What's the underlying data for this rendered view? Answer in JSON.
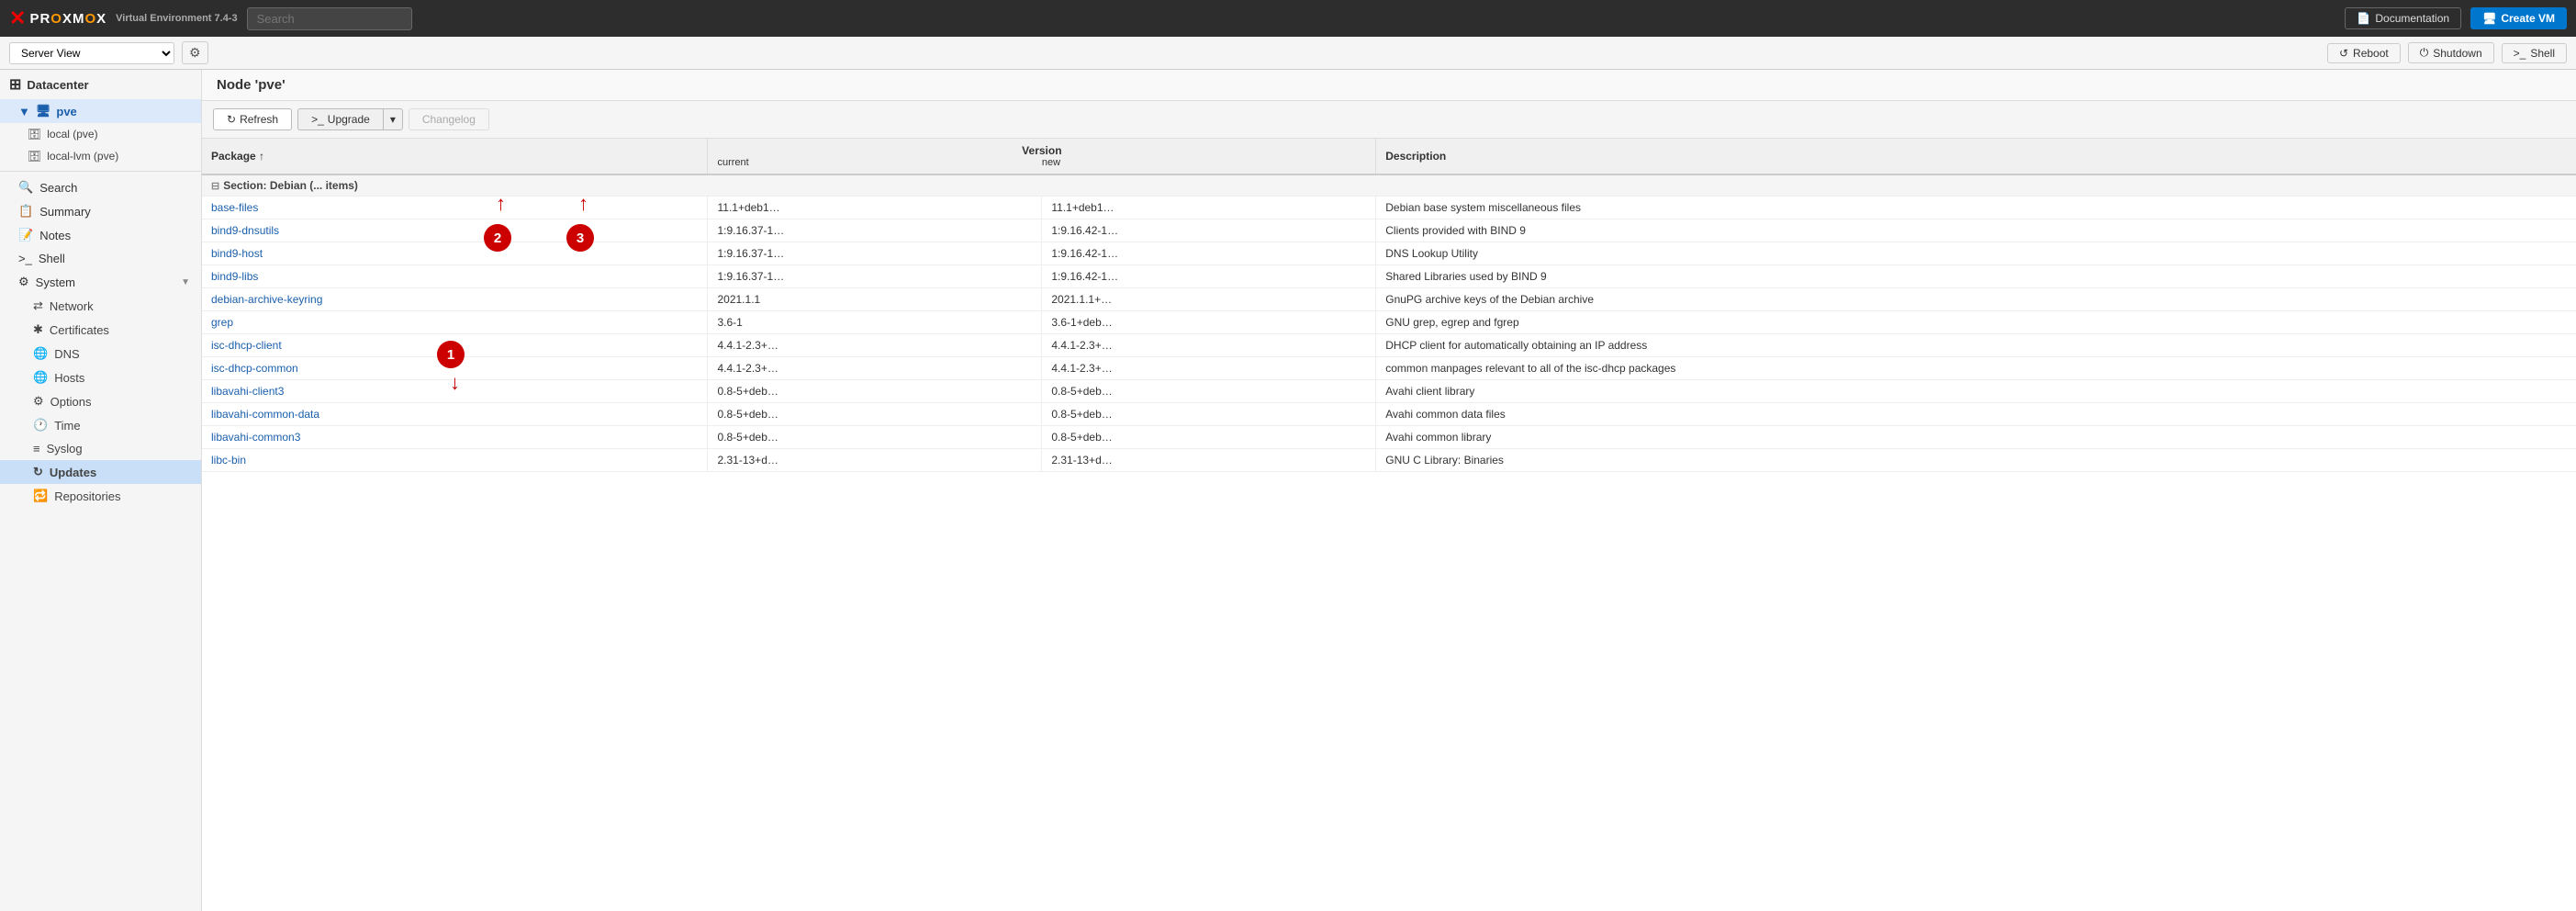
{
  "topbar": {
    "logo": {
      "brand": "PROXMOX",
      "product": "Virtual Environment 7.4-3"
    },
    "search_placeholder": "Search",
    "docs_btn": "Documentation",
    "create_vm_btn": "Create VM"
  },
  "serverbar": {
    "view_label": "Server View",
    "gear_icon": "⚙",
    "reboot_btn": "Reboot",
    "shutdown_btn": "Shutdown",
    "shell_btn": "Shell"
  },
  "sidebar": {
    "datacenter_label": "Datacenter",
    "node_label": "pve",
    "storages": [
      {
        "name": "local (pve)"
      },
      {
        "name": "local-lvm (pve)"
      }
    ],
    "menu_items": [
      {
        "id": "search",
        "icon": "🔍",
        "label": "Search"
      },
      {
        "id": "summary",
        "icon": "📋",
        "label": "Summary"
      },
      {
        "id": "notes",
        "icon": "📝",
        "label": "Notes"
      },
      {
        "id": "shell",
        "icon": ">_",
        "label": "Shell"
      },
      {
        "id": "system",
        "icon": "⚙",
        "label": "System",
        "has_arrow": true
      },
      {
        "id": "network",
        "icon": "⇄",
        "label": "Network",
        "sub": true
      },
      {
        "id": "certificates",
        "icon": "✱",
        "label": "Certificates",
        "sub": true
      },
      {
        "id": "dns",
        "icon": "🌐",
        "label": "DNS",
        "sub": true
      },
      {
        "id": "hosts",
        "icon": "🌐",
        "label": "Hosts",
        "sub": true
      },
      {
        "id": "options",
        "icon": "⚙",
        "label": "Options",
        "sub": true
      },
      {
        "id": "time",
        "icon": "🕐",
        "label": "Time",
        "sub": true
      },
      {
        "id": "syslog",
        "icon": "≡",
        "label": "Syslog",
        "sub": true
      },
      {
        "id": "updates",
        "icon": "↻",
        "label": "Updates",
        "sub": true,
        "active": true
      },
      {
        "id": "repositories",
        "icon": "🔁",
        "label": "Repositories",
        "sub": true
      }
    ]
  },
  "content": {
    "header_title": "Node 'pve'",
    "toolbar": {
      "refresh_btn": "Refresh",
      "upgrade_btn": "Upgrade",
      "upgrade_dropdown": "▾",
      "changelog_btn": "Changelog"
    },
    "table": {
      "columns": [
        {
          "id": "package",
          "label": "Package ↑"
        },
        {
          "id": "version_header",
          "label": "Version"
        },
        {
          "id": "current",
          "label": "current"
        },
        {
          "id": "new",
          "label": "new"
        },
        {
          "id": "description",
          "label": "Description"
        }
      ],
      "group": "Section: Debian (... items)",
      "rows": [
        {
          "package": "base-files",
          "current": "11.1+deb1…",
          "new": "11.1+deb1…",
          "description": "Debian base system miscellaneous files"
        },
        {
          "package": "bind9-dnsutils",
          "current": "1:9.16.37-1…",
          "new": "1:9.16.42-1…",
          "description": "Clients provided with BIND 9"
        },
        {
          "package": "bind9-host",
          "current": "1:9.16.37-1…",
          "new": "1:9.16.42-1…",
          "description": "DNS Lookup Utility"
        },
        {
          "package": "bind9-libs",
          "current": "1:9.16.37-1…",
          "new": "1:9.16.42-1…",
          "description": "Shared Libraries used by BIND 9"
        },
        {
          "package": "debian-archive-keyring",
          "current": "2021.1.1",
          "new": "2021.1.1+…",
          "description": "GnuPG archive keys of the Debian archive"
        },
        {
          "package": "grep",
          "current": "3.6-1",
          "new": "3.6-1+deb…",
          "description": "GNU grep, egrep and fgrep"
        },
        {
          "package": "isc-dhcp-client",
          "current": "4.4.1-2.3+…",
          "new": "4.4.1-2.3+…",
          "description": "DHCP client for automatically obtaining an IP address"
        },
        {
          "package": "isc-dhcp-common",
          "current": "4.4.1-2.3+…",
          "new": "4.4.1-2.3+…",
          "description": "common manpages relevant to all of the isc-dhcp packages"
        },
        {
          "package": "libavahi-client3",
          "current": "0.8-5+deb…",
          "new": "0.8-5+deb…",
          "description": "Avahi client library"
        },
        {
          "package": "libavahi-common-data",
          "current": "0.8-5+deb…",
          "new": "0.8-5+deb…",
          "description": "Avahi common data files"
        },
        {
          "package": "libavahi-common3",
          "current": "0.8-5+deb…",
          "new": "0.8-5+deb…",
          "description": "Avahi common library"
        },
        {
          "package": "libc-bin",
          "current": "2.31-13+d…",
          "new": "2.31-13+d…",
          "description": "GNU C Library: Binaries"
        }
      ]
    }
  },
  "annotations": [
    {
      "id": 1,
      "label": "1"
    },
    {
      "id": 2,
      "label": "2"
    },
    {
      "id": 3,
      "label": "3"
    }
  ]
}
